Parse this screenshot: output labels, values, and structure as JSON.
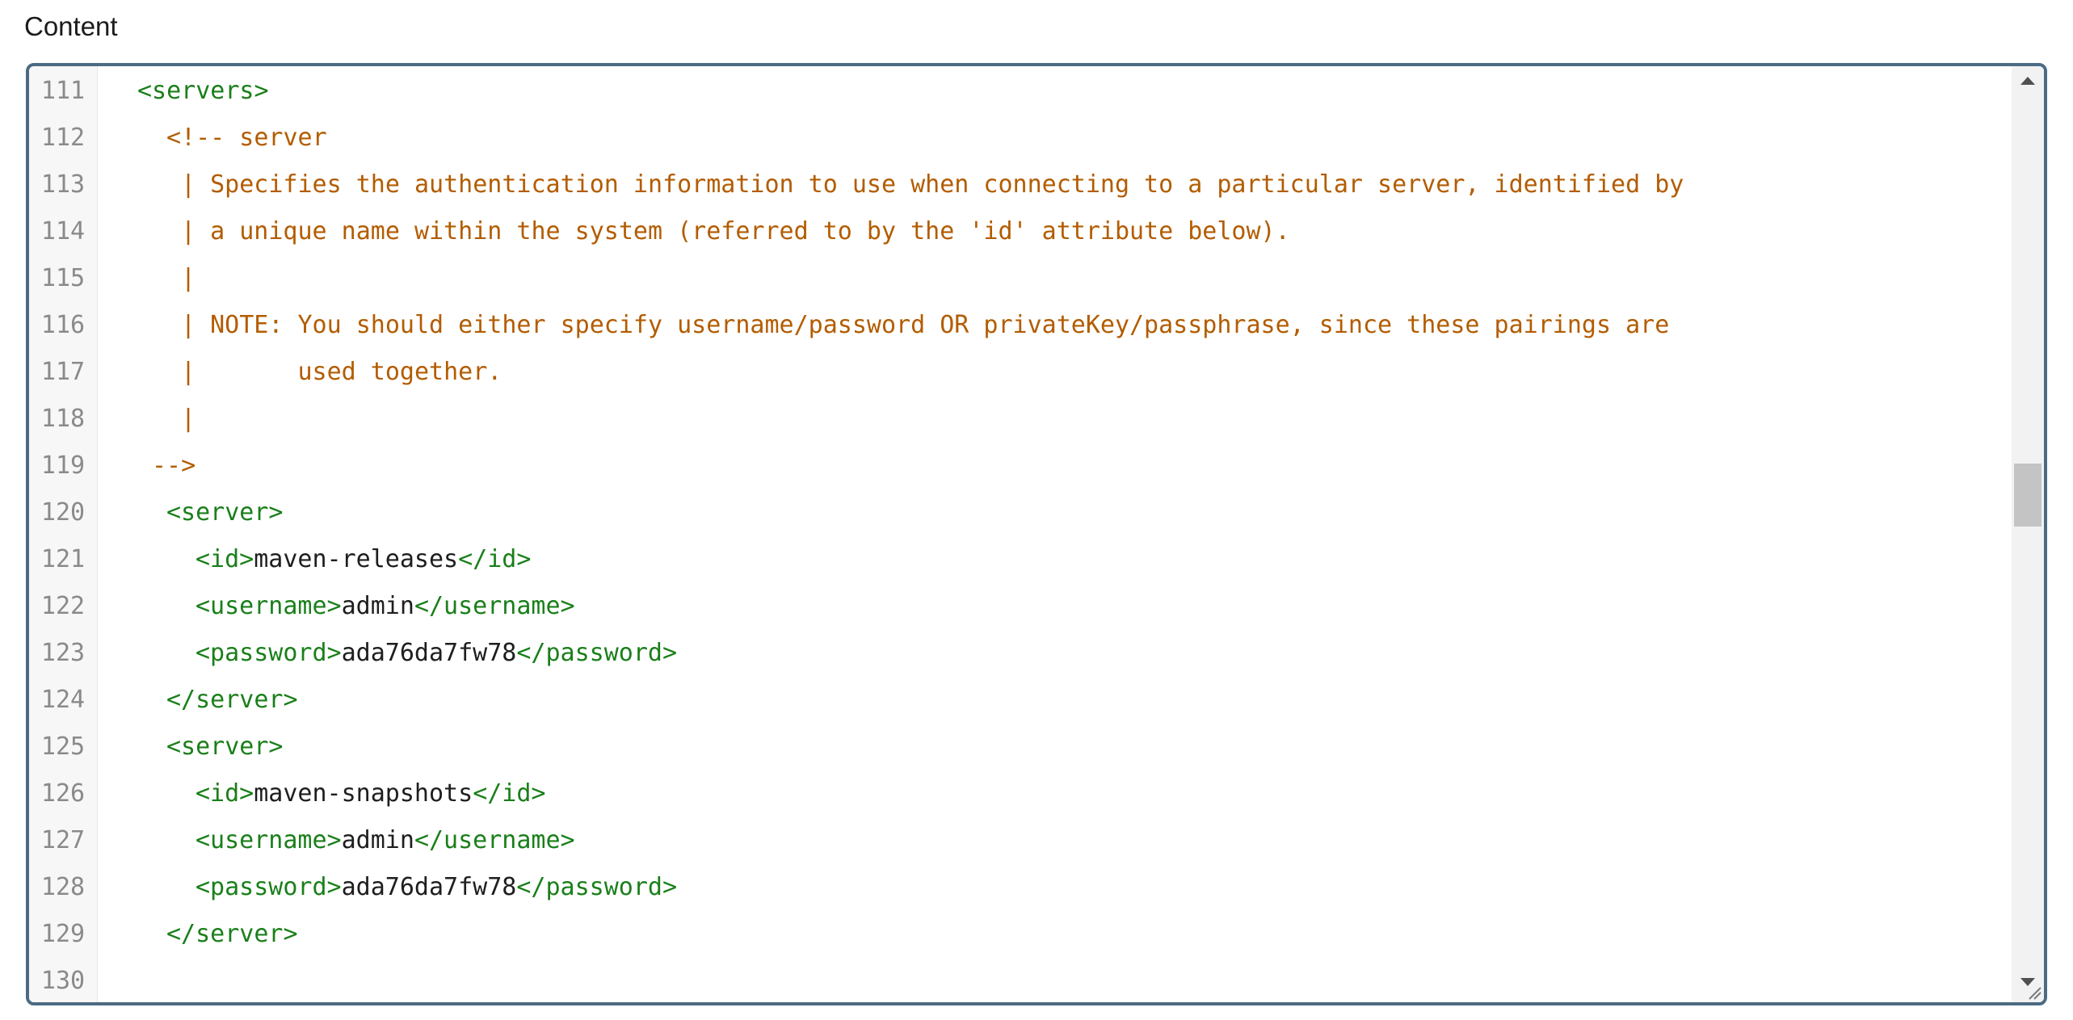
{
  "field": {
    "label": "Content"
  },
  "editor": {
    "lines": [
      {
        "n": "111",
        "segs": [
          {
            "t": "<servers>",
            "c": "tag"
          }
        ],
        "indent": 0
      },
      {
        "n": "112",
        "segs": [
          {
            "t": "<!-- server",
            "c": "comment"
          }
        ],
        "indent": 2
      },
      {
        "n": "113",
        "segs": [
          {
            "t": "| Specifies the authentication information to use when connecting to a particular server, identified by",
            "c": "comment"
          }
        ],
        "indent": 3
      },
      {
        "n": "114",
        "segs": [
          {
            "t": "| a unique name within the system (referred to by the 'id' attribute below).",
            "c": "comment"
          }
        ],
        "indent": 3
      },
      {
        "n": "115",
        "segs": [
          {
            "t": "|",
            "c": "comment"
          }
        ],
        "indent": 3
      },
      {
        "n": "116",
        "segs": [
          {
            "t": "| NOTE: You should either specify username/password OR privateKey/passphrase, since these pairings are",
            "c": "comment"
          }
        ],
        "indent": 3
      },
      {
        "n": "117",
        "segs": [
          {
            "t": "|       used together.",
            "c": "comment"
          }
        ],
        "indent": 3
      },
      {
        "n": "118",
        "segs": [
          {
            "t": "|",
            "c": "comment"
          }
        ],
        "indent": 3
      },
      {
        "n": "119",
        "segs": [
          {
            "t": "-->",
            "c": "comment"
          }
        ],
        "indent": 1
      },
      {
        "n": "120",
        "segs": [
          {
            "t": "<server>",
            "c": "tag"
          }
        ],
        "indent": 2
      },
      {
        "n": "121",
        "segs": [
          {
            "t": "<id>",
            "c": "tag"
          },
          {
            "t": "maven-releases",
            "c": "text"
          },
          {
            "t": "</id>",
            "c": "tag"
          }
        ],
        "indent": 4
      },
      {
        "n": "122",
        "segs": [
          {
            "t": "<username>",
            "c": "tag"
          },
          {
            "t": "admin",
            "c": "text"
          },
          {
            "t": "</username>",
            "c": "tag"
          }
        ],
        "indent": 4
      },
      {
        "n": "123",
        "segs": [
          {
            "t": "<password>",
            "c": "tag"
          },
          {
            "t": "ada76da7fw78",
            "c": "text"
          },
          {
            "t": "</password>",
            "c": "tag"
          }
        ],
        "indent": 4
      },
      {
        "n": "124",
        "segs": [
          {
            "t": "</server>",
            "c": "tag"
          }
        ],
        "indent": 2
      },
      {
        "n": "125",
        "segs": [
          {
            "t": "<server>",
            "c": "tag"
          }
        ],
        "indent": 2
      },
      {
        "n": "126",
        "segs": [
          {
            "t": "<id>",
            "c": "tag"
          },
          {
            "t": "maven-snapshots",
            "c": "text"
          },
          {
            "t": "</id>",
            "c": "tag"
          }
        ],
        "indent": 4
      },
      {
        "n": "127",
        "segs": [
          {
            "t": "<username>",
            "c": "tag"
          },
          {
            "t": "admin",
            "c": "text"
          },
          {
            "t": "</username>",
            "c": "tag"
          }
        ],
        "indent": 4
      },
      {
        "n": "128",
        "segs": [
          {
            "t": "<password>",
            "c": "tag"
          },
          {
            "t": "ada76da7fw78",
            "c": "text"
          },
          {
            "t": "</password>",
            "c": "tag"
          }
        ],
        "indent": 4
      },
      {
        "n": "129",
        "segs": [
          {
            "t": "</server>",
            "c": "tag"
          }
        ],
        "indent": 2
      },
      {
        "n": "130",
        "segs": [],
        "indent": 0
      }
    ]
  },
  "colors": {
    "tag": "#1a7f1a",
    "comment": "#b35c00",
    "text": "#1e1e1e",
    "line_number": "#8a8a8a",
    "border": "#4b6b83"
  },
  "icons": {
    "scroll_up": "chevron-up-icon",
    "scroll_down": "chevron-down-icon",
    "resize": "resize-grip-icon"
  }
}
